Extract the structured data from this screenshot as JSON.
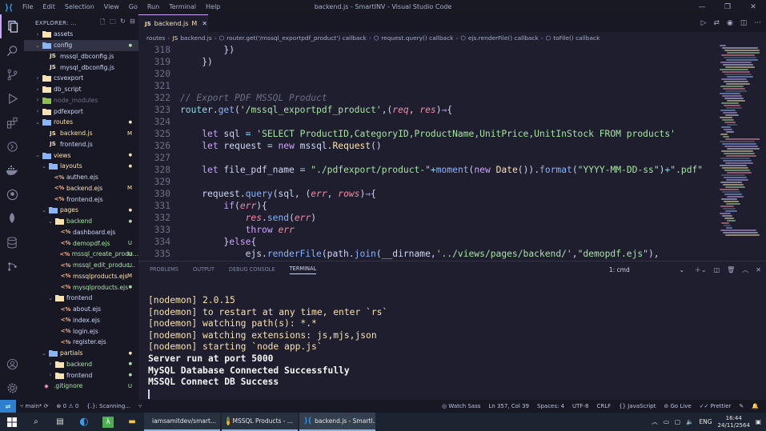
{
  "window": {
    "title": "backend.js - SmartINV - Visual Studio Code",
    "menu": [
      "File",
      "Edit",
      "Selection",
      "View",
      "Go",
      "Run",
      "Terminal",
      "Help"
    ]
  },
  "sidebar": {
    "header": "EXPLORER: ...",
    "items": [
      {
        "label": "assets",
        "type": "folder",
        "depth": 1,
        "open": false,
        "badge": ""
      },
      {
        "label": "config",
        "type": "folder",
        "depth": 1,
        "open": true,
        "badge": "dot",
        "selected": true
      },
      {
        "label": "mssql_dbconfig.js",
        "type": "js",
        "depth": 2,
        "badge": ""
      },
      {
        "label": "mysql_dbconfig.js",
        "type": "js",
        "depth": 2,
        "badge": ""
      },
      {
        "label": "csvexport",
        "type": "folder",
        "depth": 1,
        "open": false,
        "badge": ""
      },
      {
        "label": "db_script",
        "type": "folder",
        "depth": 1,
        "open": false,
        "badge": ""
      },
      {
        "label": "node_modules",
        "type": "folder",
        "depth": 1,
        "open": false,
        "badge": "",
        "dim": true
      },
      {
        "label": "pdfexport",
        "type": "folder",
        "depth": 1,
        "open": false,
        "badge": ""
      },
      {
        "label": "routes",
        "type": "folder",
        "depth": 1,
        "open": true,
        "badge": "dot"
      },
      {
        "label": "backend.js",
        "type": "js",
        "depth": 2,
        "badge": "M"
      },
      {
        "label": "frontend.js",
        "type": "js",
        "depth": 2,
        "badge": ""
      },
      {
        "label": "views",
        "type": "folder",
        "depth": 1,
        "open": true,
        "badge": "dot"
      },
      {
        "label": "layouts",
        "type": "folder",
        "depth": 2,
        "open": true,
        "badge": "dot"
      },
      {
        "label": "authen.ejs",
        "type": "ejs",
        "depth": 3,
        "badge": ""
      },
      {
        "label": "backend.ejs",
        "type": "ejs",
        "depth": 3,
        "badge": "M"
      },
      {
        "label": "frontend.ejs",
        "type": "ejs",
        "depth": 3,
        "badge": ""
      },
      {
        "label": "pages",
        "type": "folder",
        "depth": 2,
        "open": true,
        "badge": "dot"
      },
      {
        "label": "backend",
        "type": "folder",
        "depth": 3,
        "open": true,
        "badge": "dot"
      },
      {
        "label": "dashboard.ejs",
        "type": "ejs",
        "depth": 4,
        "badge": ""
      },
      {
        "label": "demopdf.ejs",
        "type": "ejs",
        "depth": 4,
        "badge": "U"
      },
      {
        "label": "mssql_create_produ...",
        "type": "ejs",
        "depth": 4,
        "badge": "U"
      },
      {
        "label": "mssql_edit_produc...",
        "type": "ejs",
        "depth": 4,
        "badge": "U"
      },
      {
        "label": "mssqlproducts.ejs",
        "type": "ejs",
        "depth": 4,
        "badge": "M"
      },
      {
        "label": "mysqlproducts.ejs",
        "type": "ejs",
        "depth": 4,
        "badge": "dot"
      },
      {
        "label": "frontend",
        "type": "folder",
        "depth": 3,
        "open": true,
        "badge": ""
      },
      {
        "label": "about.ejs",
        "type": "ejs",
        "depth": 4,
        "badge": ""
      },
      {
        "label": "index.ejs",
        "type": "ejs",
        "depth": 4,
        "badge": ""
      },
      {
        "label": "login.ejs",
        "type": "ejs",
        "depth": 4,
        "badge": ""
      },
      {
        "label": "register.ejs",
        "type": "ejs",
        "depth": 4,
        "badge": ""
      },
      {
        "label": "partials",
        "type": "folder",
        "depth": 2,
        "open": true,
        "badge": "dot"
      },
      {
        "label": "backend",
        "type": "folder",
        "depth": 3,
        "open": false,
        "badge": "dot"
      },
      {
        "label": "frontend",
        "type": "folder",
        "depth": 3,
        "open": false,
        "badge": "dot"
      },
      {
        "label": ".gitignore",
        "type": "git",
        "depth": 1,
        "badge": "U"
      }
    ]
  },
  "editor": {
    "tab_label": "backend.js",
    "tab_badge": "M",
    "breadcrumbs": [
      "routes",
      "backend.js",
      "router.get('/mssql_exportpdf_product') callback",
      "request.query() callback",
      "ejs.renderFile() callback",
      "toFile() callback"
    ],
    "lines": [
      {
        "n": "318",
        "segs": [
          [
            "t",
            "        })"
          ]
        ]
      },
      {
        "n": "319",
        "segs": [
          [
            "t",
            "    })"
          ]
        ]
      },
      {
        "n": "320",
        "segs": [
          [
            "t",
            ""
          ]
        ]
      },
      {
        "n": "321",
        "segs": [
          [
            "t",
            ""
          ]
        ]
      },
      {
        "n": "322",
        "segs": [
          [
            "c",
            "// Export PDF MSSQL Product"
          ]
        ]
      },
      {
        "n": "323",
        "segs": [
          [
            "o",
            "router"
          ],
          [
            "t",
            "."
          ],
          [
            "f",
            "get"
          ],
          [
            "t",
            "("
          ],
          [
            "s",
            "'/mssql_exportpdf_product'"
          ],
          [
            "t",
            ",("
          ],
          [
            "p",
            "req"
          ],
          [
            "t",
            ", "
          ],
          [
            "p",
            "res"
          ],
          [
            "t",
            ")"
          ],
          [
            "k",
            "⇒"
          ],
          [
            "t",
            "{"
          ]
        ]
      },
      {
        "n": "324",
        "segs": [
          [
            "t",
            ""
          ]
        ]
      },
      {
        "n": "325",
        "segs": [
          [
            "t",
            "    "
          ],
          [
            "k",
            "let"
          ],
          [
            "t",
            " sql "
          ],
          [
            "o",
            "="
          ],
          [
            "t",
            " "
          ],
          [
            "s",
            "'SELECT ProductID,CategoryID,ProductName,UnitPrice,UnitInStock FROM products'"
          ]
        ]
      },
      {
        "n": "326",
        "segs": [
          [
            "t",
            "    "
          ],
          [
            "k",
            "let"
          ],
          [
            "t",
            " request "
          ],
          [
            "o",
            "="
          ],
          [
            "t",
            " "
          ],
          [
            "k",
            "new"
          ],
          [
            "t",
            " mssql."
          ],
          [
            "y",
            "Request"
          ],
          [
            "t",
            "()"
          ]
        ]
      },
      {
        "n": "327",
        "segs": [
          [
            "t",
            ""
          ]
        ]
      },
      {
        "n": "328",
        "segs": [
          [
            "t",
            "    "
          ],
          [
            "k",
            "let"
          ],
          [
            "t",
            " file_pdf_name "
          ],
          [
            "o",
            "="
          ],
          [
            "t",
            " "
          ],
          [
            "s",
            "\"./pdfexport/product-\""
          ],
          [
            "o",
            "+"
          ],
          [
            "f",
            "moment"
          ],
          [
            "t",
            "("
          ],
          [
            "k",
            "new"
          ],
          [
            "t",
            " "
          ],
          [
            "y",
            "Date"
          ],
          [
            "t",
            "())."
          ],
          [
            "f",
            "format"
          ],
          [
            "t",
            "("
          ],
          [
            "s",
            "\"YYYY-MM-DD-ss\""
          ],
          [
            "t",
            ")"
          ],
          [
            "o",
            "+"
          ],
          [
            "s",
            "\".pdf\""
          ]
        ]
      },
      {
        "n": "329",
        "segs": [
          [
            "t",
            ""
          ]
        ]
      },
      {
        "n": "330",
        "segs": [
          [
            "t",
            "    request."
          ],
          [
            "f",
            "query"
          ],
          [
            "t",
            "(sql, ("
          ],
          [
            "p",
            "err"
          ],
          [
            "t",
            ", "
          ],
          [
            "p",
            "rows"
          ],
          [
            "t",
            ")"
          ],
          [
            "k",
            "⇒"
          ],
          [
            "t",
            "{"
          ]
        ]
      },
      {
        "n": "331",
        "segs": [
          [
            "t",
            "        "
          ],
          [
            "k",
            "if"
          ],
          [
            "t",
            "("
          ],
          [
            "p",
            "err"
          ],
          [
            "t",
            "){"
          ]
        ]
      },
      {
        "n": "332",
        "segs": [
          [
            "t",
            "            "
          ],
          [
            "p",
            "res"
          ],
          [
            "t",
            "."
          ],
          [
            "f",
            "send"
          ],
          [
            "t",
            "("
          ],
          [
            "p",
            "err"
          ],
          [
            "t",
            ")"
          ]
        ]
      },
      {
        "n": "333",
        "segs": [
          [
            "t",
            "            "
          ],
          [
            "k",
            "throw"
          ],
          [
            "t",
            " "
          ],
          [
            "p",
            "err"
          ]
        ]
      },
      {
        "n": "334",
        "segs": [
          [
            "t",
            "        }"
          ],
          [
            "k",
            "else"
          ],
          [
            "t",
            "{"
          ]
        ]
      },
      {
        "n": "335",
        "segs": [
          [
            "t",
            "            ejs."
          ],
          [
            "f",
            "renderFile"
          ],
          [
            "t",
            "(path."
          ],
          [
            "f",
            "join"
          ],
          [
            "t",
            "(__dirname,"
          ],
          [
            "s",
            "'../views/pages/backend/'"
          ],
          [
            "t",
            ","
          ],
          [
            "s",
            "\"demopdf.ejs\""
          ],
          [
            "t",
            "),"
          ]
        ]
      }
    ]
  },
  "panel": {
    "tabs": [
      "PROBLEMS",
      "OUTPUT",
      "DEBUG CONSOLE",
      "TERMINAL"
    ],
    "active_tab": "TERMINAL",
    "terminal_select": "1: cmd",
    "output": [
      {
        "text": "[nodemon] 2.0.15",
        "style": "tnm"
      },
      {
        "text": "[nodemon] to restart at any time, enter `rs`",
        "style": "tnm"
      },
      {
        "text": "[nodemon] watching path(s): *.*",
        "style": "tnm"
      },
      {
        "text": "[nodemon] watching extensions: js,mjs,json",
        "style": "tnm"
      },
      {
        "text": "[nodemon] starting `node app.js`",
        "style": "tnm"
      },
      {
        "text": "Server run at port 5000",
        "style": "tw"
      },
      {
        "text": "MySQL Database Connected Successfully",
        "style": "tw"
      },
      {
        "text": "MSSQL Connect DB Success",
        "style": "tw"
      }
    ]
  },
  "statusbar": {
    "branch": "main*",
    "errors": "0",
    "warnings": "0",
    "task": "{.}: Scanning...",
    "watch_sass": "Watch Sass",
    "position": "Ln 357, Col 39",
    "spaces": "Spaces: 4",
    "encoding": "UTF-8",
    "eol": "CRLF",
    "language": "JavaScript",
    "golive": "Go Live",
    "prettier": "Prettier"
  },
  "taskbar": {
    "apps": [
      {
        "label": "iamsamitdev/smart...",
        "color": "#4caf50"
      },
      {
        "label": "MSSQL Products - ...",
        "color": "#e53935"
      },
      {
        "label": "backend.js - SmartI...",
        "color": "#2d9bf0"
      }
    ],
    "lang": "ENG",
    "time": "16:44",
    "date": "24/11/2564"
  },
  "colors": {
    "accent": "#cba6f7",
    "modified": "#f9e2af",
    "untracked": "#a6e3a1"
  }
}
